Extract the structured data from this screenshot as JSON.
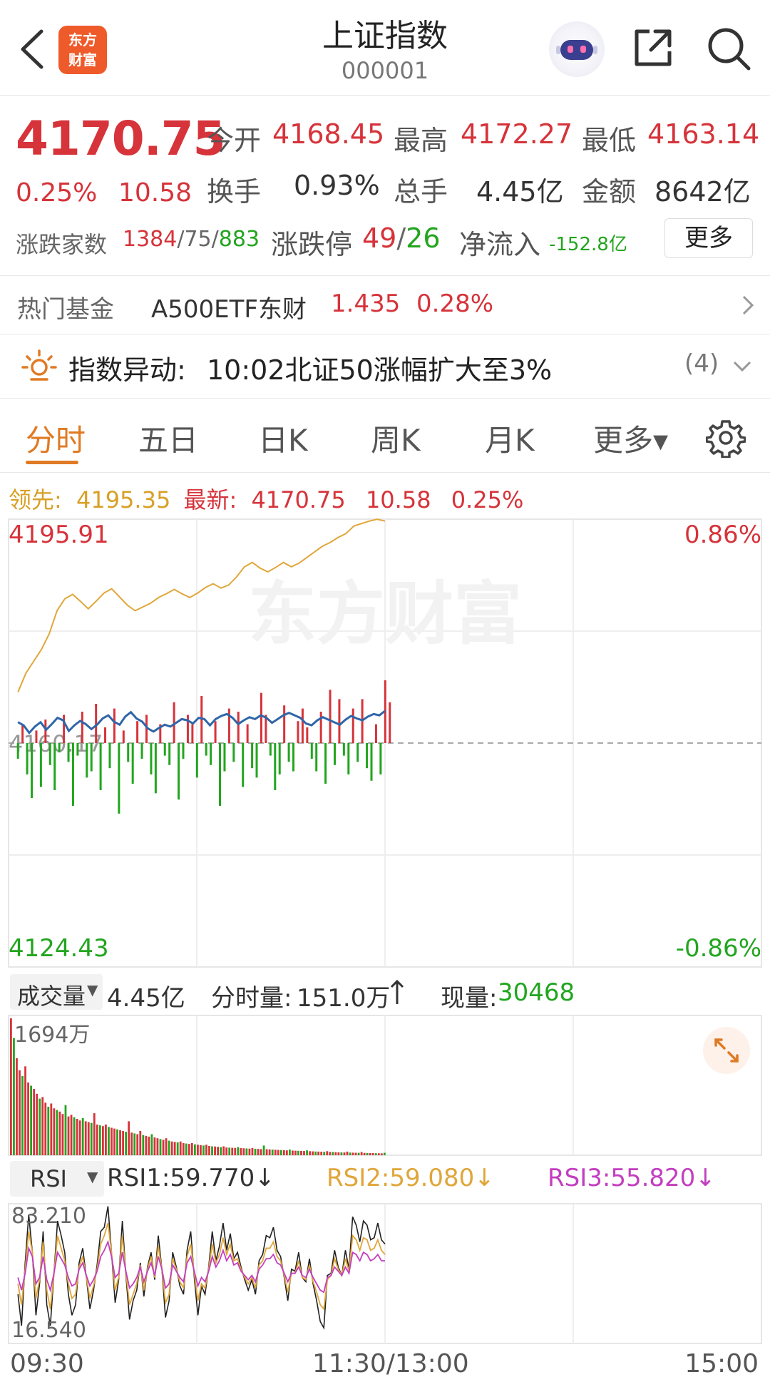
{
  "header": {
    "title": "上证指数",
    "code": "000001",
    "logo_text_line1": "东方",
    "logo_text_line2": "财富"
  },
  "quote": {
    "price": "4170.75",
    "change_pct": "0.25%",
    "change": "10.58",
    "open_label": "今开",
    "open": "4168.45",
    "high_label": "最高",
    "high": "4172.27",
    "low_label": "最低",
    "low": "4163.14",
    "turnover_label": "换手",
    "turnover": "0.93%",
    "volume_label": "总手",
    "volume": "4.45亿",
    "amount_label": "金额",
    "amount": "8642亿",
    "breadth_label": "涨跌家数",
    "breadth_up": "1384",
    "breadth_flat": "75",
    "breadth_down": "883",
    "limit_label": "涨跌停",
    "limit_up": "49",
    "limit_down": "26",
    "netflow_label": "净流入",
    "netflow": "-152.8亿",
    "more_label": "更多",
    "slash": "/"
  },
  "fund": {
    "label": "热门基金",
    "name": "A500ETF东财",
    "price": "1.435",
    "pct": "0.28%"
  },
  "alert": {
    "title": "指数异动:",
    "text": "10:02北证50涨幅扩大至3%",
    "count": "(4)"
  },
  "tabs": [
    "分时",
    "五日",
    "日K",
    "周K",
    "月K",
    "更多▾"
  ],
  "lead": {
    "lead_label": "领先:",
    "lead_value": "4195.35",
    "latest_label": "最新:",
    "latest_value": "4170.75",
    "change": "10.58",
    "pct": "0.25%"
  },
  "intraday": {
    "top_price": "4195.91",
    "bottom_price": "4124.43",
    "top_pct": "0.86%",
    "bottom_pct": "-0.86%",
    "base_price": "4160.17",
    "watermark": "东方财富"
  },
  "volume": {
    "label": "成交量",
    "total": "4.45亿",
    "minute_label": "分时量:",
    "minute_value": "151.0万",
    "current_label": "现量:",
    "current_value": "30468",
    "max_label": "1694万"
  },
  "rsi": {
    "label": "RSI",
    "rsi1": "RSI1:59.770",
    "rsi2": "RSI2:59.080",
    "rsi3": "RSI3:55.820",
    "max": "83.210",
    "min": "16.540"
  },
  "time_axis": [
    "09:30",
    "11:30/13:00",
    "15:00"
  ],
  "colors": {
    "up": "#d6333a",
    "down": "#22a51f",
    "accent": "#e07a24",
    "price_line": "#2f66a8",
    "lead_line": "#e0a63a",
    "rsi2": "#e0a63a",
    "rsi3": "#c33ec0"
  },
  "chart_data": [
    {
      "type": "line",
      "title": "",
      "series": [
        {
          "name": "最新",
          "values": [
            4163.5,
            4163.0,
            4161.8,
            4162.8,
            4163.5,
            4162.3,
            4163.2,
            4164.2,
            4163.8,
            4162.1,
            4163.0,
            4163.7,
            4163.2,
            4162.4,
            4163.1,
            4164.1,
            4164.6,
            4163.6,
            4163.1,
            4164.4,
            4165.1,
            4164.1,
            4163.6,
            4162.5,
            4162.0,
            4162.6,
            4163.1,
            4162.8,
            4163.4,
            4164.0,
            4163.8,
            4163.3,
            4164.2,
            4164.0,
            4163.0,
            4164.0,
            4164.5,
            4164.8,
            4164.2,
            4163.2,
            4163.8,
            4164.3,
            4164.0,
            4164.6,
            4164.2,
            4163.4,
            4164.0,
            4164.6,
            4165.0,
            4164.6,
            4164.2,
            4163.3,
            4163.0,
            4163.8,
            4164.3,
            4163.9,
            4163.5,
            4163.1,
            4163.9,
            4164.5,
            4164.1,
            4163.8,
            4164.4,
            4164.8,
            4164.6,
            4165.3
          ]
        },
        {
          "name": "领先",
          "values": [
            4168.3,
            4171.3,
            4173.2,
            4175.1,
            4177.6,
            4181.3,
            4183.2,
            4183.9,
            4182.8,
            4181.6,
            4182.8,
            4184.1,
            4184.8,
            4183.5,
            4182.2,
            4181.3,
            4181.9,
            4182.5,
            4183.4,
            4184.0,
            4184.7,
            4184.0,
            4183.4,
            4184.1,
            4185.0,
            4185.6,
            4184.9,
            4185.4,
            4186.7,
            4188.3,
            4189.0,
            4188.1,
            4187.5,
            4188.2,
            4189.0,
            4188.3,
            4188.9,
            4189.8,
            4190.7,
            4191.6,
            4192.2,
            4193.0,
            4193.6,
            4194.8,
            4195.2,
            4195.6,
            4195.9,
            4195.6
          ]
        }
      ],
      "ylim": [
        4124.43,
        4195.91
      ],
      "baseline": 4160.17,
      "xlabel": "",
      "ylabel": ""
    },
    {
      "type": "bar",
      "title": "",
      "values": [
        1694,
        1450,
        1200,
        1050,
        980,
        1100,
        900,
        860,
        820,
        760,
        700,
        720,
        650,
        600,
        640,
        580,
        560,
        540,
        510,
        620,
        480,
        500,
        470,
        450,
        430,
        460,
        420,
        410,
        400,
        520,
        380,
        370,
        360,
        380,
        350,
        340,
        330,
        320,
        310,
        300,
        290,
        420,
        280,
        270,
        260,
        300,
        250,
        240,
        230,
        260,
        220,
        210,
        200,
        190,
        210,
        180,
        170,
        165,
        160,
        170,
        150,
        145,
        140,
        150,
        135,
        130,
        125,
        120,
        130,
        115,
        110,
        108,
        105,
        100,
        110,
        96,
        94,
        92,
        90,
        100,
        88,
        86,
        84,
        82,
        90,
        80,
        78,
        76,
        120,
        74,
        72,
        70,
        68,
        66,
        64,
        62,
        60,
        70,
        58,
        56,
        55,
        54,
        52,
        60,
        50,
        48,
        46,
        45,
        44,
        42,
        50,
        41,
        40,
        38,
        36,
        35,
        34,
        45,
        33,
        32,
        31,
        30,
        40,
        29,
        28,
        27,
        26,
        25,
        24,
        23,
        30
      ],
      "ylim": [
        0,
        1694
      ]
    },
    {
      "type": "line",
      "title": "",
      "series": [
        {
          "name": "RSI1",
          "values": [
            40,
            25,
            55,
            78,
            60,
            30,
            45,
            70,
            35,
            25,
            50,
            75,
            68,
            60,
            40,
            30,
            35,
            55,
            62,
            48,
            33,
            42,
            54,
            70,
            72,
            82,
            60,
            36,
            47,
            75,
            49,
            28,
            37,
            42,
            55,
            39,
            53,
            60,
            47,
            68,
            52,
            29,
            37,
            60,
            53,
            44,
            40,
            61,
            70,
            48,
            30,
            44,
            40,
            53,
            70,
            56,
            63,
            74,
            61,
            69,
            57,
            60,
            53,
            47,
            42,
            47,
            40,
            56,
            59,
            68,
            67,
            72,
            61,
            58,
            48,
            37,
            52,
            51,
            60,
            48,
            46,
            57,
            45,
            37,
            27,
            24,
            49,
            50,
            61,
            53,
            49,
            61,
            52,
            77,
            73,
            65,
            75,
            73,
            66,
            67,
            74,
            66,
            64
          ]
        },
        {
          "name": "RSI2",
          "values": [
            45,
            35,
            52,
            70,
            60,
            38,
            47,
            65,
            42,
            33,
            50,
            68,
            62,
            56,
            45,
            38,
            40,
            53,
            58,
            48,
            38,
            44,
            52,
            64,
            68,
            74,
            60,
            42,
            48,
            68,
            50,
            35,
            40,
            45,
            54,
            42,
            52,
            58,
            48,
            63,
            52,
            36,
            40,
            57,
            52,
            46,
            43,
            58,
            64,
            50,
            37,
            45,
            43,
            52,
            64,
            55,
            59,
            67,
            59,
            64,
            56,
            57,
            52,
            48,
            45,
            48,
            43,
            54,
            56,
            62,
            62,
            65,
            58,
            56,
            49,
            41,
            50,
            50,
            56,
            48,
            47,
            54,
            46,
            41,
            35,
            33,
            47,
            49,
            57,
            52,
            49,
            57,
            51,
            68,
            66,
            61,
            67,
            66,
            61,
            62,
            66,
            61,
            59
          ]
        },
        {
          "name": "RSI3",
          "values": [
            48,
            42,
            50,
            62,
            58,
            45,
            48,
            58,
            47,
            42,
            50,
            60,
            57,
            54,
            48,
            44,
            45,
            52,
            55,
            49,
            44,
            47,
            51,
            58,
            61,
            65,
            58,
            48,
            50,
            60,
            51,
            43,
            45,
            48,
            53,
            46,
            51,
            55,
            49,
            58,
            52,
            43,
            45,
            54,
            51,
            48,
            46,
            55,
            58,
            51,
            44,
            48,
            46,
            51,
            58,
            53,
            56,
            61,
            56,
            59,
            54,
            55,
            51,
            49,
            47,
            49,
            46,
            52,
            54,
            57,
            57,
            59,
            55,
            54,
            50,
            46,
            50,
            50,
            53,
            49,
            48,
            52,
            48,
            45,
            42,
            41,
            48,
            49,
            53,
            51,
            49,
            53,
            50,
            60,
            59,
            56,
            60,
            59,
            56,
            57,
            59,
            56,
            56
          ]
        }
      ],
      "ylim": [
        16.54,
        83.21
      ]
    }
  ]
}
